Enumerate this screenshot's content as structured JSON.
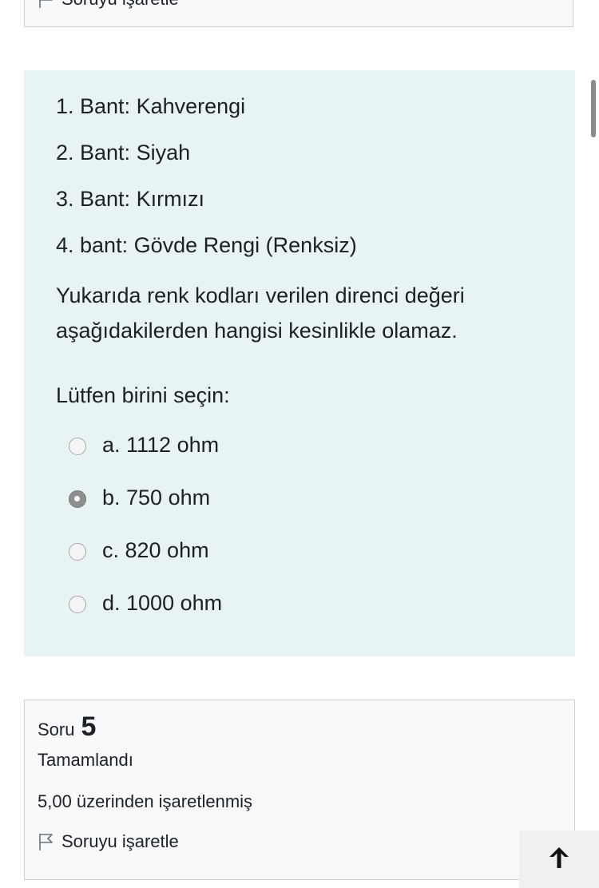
{
  "prev_question": {
    "flag_label": "Soruyu işaretle"
  },
  "question": {
    "bands": [
      "1. Bant: Kahverengi",
      "2. Bant: Siyah",
      "3. Bant: Kırmızı",
      "4. bant: Gövde Rengi (Renksiz)"
    ],
    "text": "Yukarıda renk kodları verilen direnci değeri aşağıdakilerden hangisi kesinlikle olamaz.",
    "prompt": "Lütfen birini seçin:",
    "answers": [
      {
        "label": "a. 1112 ohm",
        "selected": false
      },
      {
        "label": "b. 750 ohm",
        "selected": true
      },
      {
        "label": "c. 820 ohm",
        "selected": false
      },
      {
        "label": "d. 1000 ohm",
        "selected": false
      }
    ]
  },
  "next_question": {
    "soru_label": "Soru",
    "number": "5",
    "state": "Tamamlandı",
    "grade": "5,00 üzerinden işaretlenmiş",
    "flag_label": "Soruyu işaretle"
  },
  "icons": {
    "flag": "flag-icon",
    "back_to_top": "arrow-up-icon"
  },
  "colors": {
    "question_bg": "#e7f3f5",
    "info_bg": "#f8f9fa",
    "border": "#cfd1d6"
  }
}
